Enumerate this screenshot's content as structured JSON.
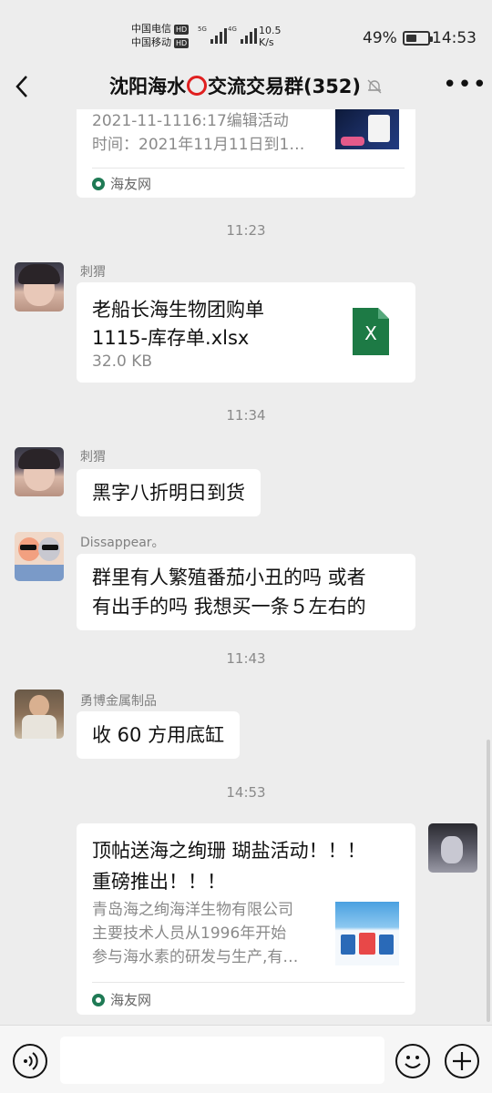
{
  "status_bar": {
    "carrier1": "中国电信",
    "carrier2": "中国移动",
    "hd": "HD",
    "net1": "5G",
    "net2": "4G",
    "speed_value": "10.5",
    "speed_unit": "K/s",
    "battery_percent": "49%",
    "battery_level": 0.49,
    "time": "14:53"
  },
  "header": {
    "title_before": "沈阳海水",
    "title_after": "交流交易群(352)",
    "more": "•••"
  },
  "messages": {
    "card1": {
      "line1": "2021-11-1116:17编辑活动",
      "line2": "时间：2021年11月11日到1…",
      "source": "海友网"
    },
    "time1": "11:23",
    "file_msg": {
      "sender": "刺猬",
      "name_line1": "老船长海生物团购单",
      "name_line2": "1115-库存单.xlsx",
      "size": "32.0 KB",
      "icon_letter": "X"
    },
    "time2": "11:34",
    "msg1": {
      "sender": "刺猬",
      "text": "黑字八折明日到货"
    },
    "msg2": {
      "sender": "Dissappear。",
      "line1": "群里有人繁殖番茄小丑的吗 或者",
      "line2": "有出手的吗 我想买一条５左右的"
    },
    "time3": "11:43",
    "msg3": {
      "sender": "勇博金属制品",
      "text": "收 60 方用底缸"
    },
    "time4": "14:53",
    "card2": {
      "title_line1": "顶帖送海之绚珊 瑚盐活动！！！",
      "title_line2": "重磅推出！！！",
      "desc_line1": "青岛海之绚海洋生物有限公司",
      "desc_line2": "主要技术人员从1996年开始",
      "desc_line3": "参与海水素的研发与生产,有…",
      "source": "海友网"
    }
  },
  "colors": {
    "background": "#ededed",
    "bubble": "#ffffff",
    "excel_green": "#1d7a45",
    "secondary_text": "#8a8a8a"
  },
  "icons": [
    "back-icon",
    "mute-bell-icon",
    "more-icon",
    "excel-file-icon",
    "voice-icon",
    "emoji-icon",
    "plus-icon"
  ]
}
